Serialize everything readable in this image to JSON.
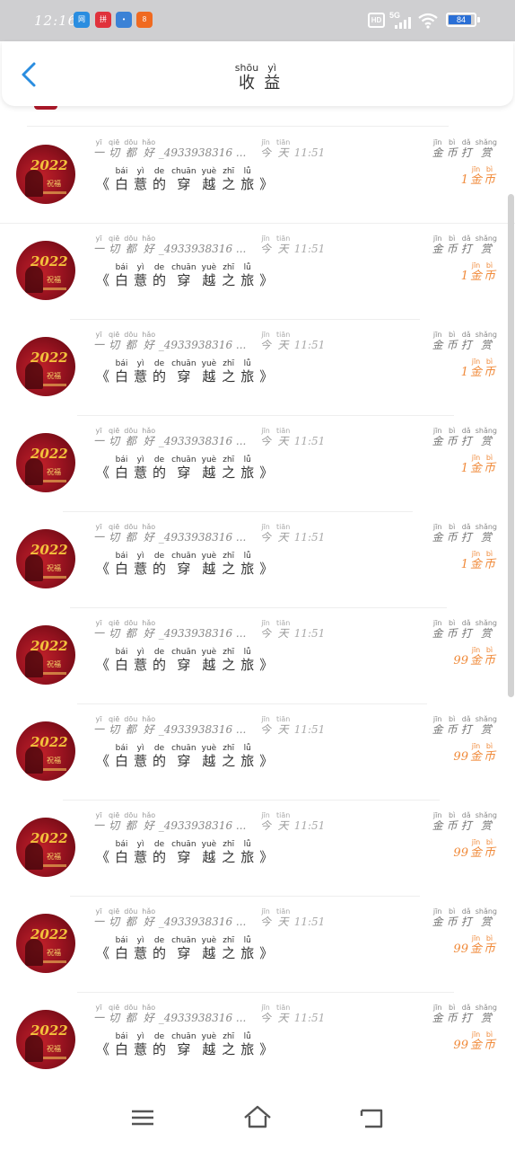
{
  "status_bar": {
    "time": "12:16",
    "apps": [
      {
        "icon": "app-blue-icon",
        "text": "网",
        "color": "#2a8de0"
      },
      {
        "icon": "app-red-icon",
        "text": "拼",
        "color": "#e0323c"
      },
      {
        "icon": "app-map-icon",
        "text": "•",
        "color": "#3b82d6"
      },
      {
        "icon": "app-orange-icon",
        "text": "8",
        "color": "#f06a20"
      }
    ],
    "hd": "HD",
    "network": "5G",
    "battery": "84",
    "battery_level": 0.84
  },
  "header": {
    "title_chars": [
      {
        "char": "收",
        "pinyin": "shōu"
      },
      {
        "char": "益",
        "pinyin": "yì"
      }
    ]
  },
  "avatar": {
    "year": "2022",
    "sub": "祝福"
  },
  "rows": [
    {
      "name": [
        {
          "c": "一",
          "p": "yī"
        },
        {
          "c": "切",
          "p": "qiē"
        },
        {
          "c": "都",
          "p": "dōu"
        },
        {
          "c": "好",
          "p": "hǎo"
        }
      ],
      "uid": "_4933938316 ...",
      "time": [
        {
          "c": "今",
          "p": "jīn"
        },
        {
          "c": "天",
          "p": "tiān"
        }
      ],
      "clock": "11:51",
      "tag": [
        {
          "c": "金",
          "p": "jīn"
        },
        {
          "c": "币",
          "p": "bì"
        },
        {
          "c": "打",
          "p": "dǎ"
        },
        {
          "c": "赏",
          "p": "shǎng"
        }
      ],
      "book": [
        {
          "c": "《",
          "p": ""
        },
        {
          "c": "白",
          "p": "bái"
        },
        {
          "c": "薏",
          "p": "yì"
        },
        {
          "c": "的",
          "p": "de"
        },
        {
          "c": "穿",
          "p": "chuān"
        },
        {
          "c": "越",
          "p": "yuè"
        },
        {
          "c": "之",
          "p": "zhī"
        },
        {
          "c": "旅",
          "p": "lǚ"
        },
        {
          "c": "》",
          "p": ""
        }
      ],
      "amount_num": "1",
      "amount_unit": [
        {
          "c": "金",
          "p": "jīn"
        },
        {
          "c": "币",
          "p": "bì"
        }
      ]
    },
    {
      "name": [
        {
          "c": "一",
          "p": "yī"
        },
        {
          "c": "切",
          "p": "qiē"
        },
        {
          "c": "都",
          "p": "dōu"
        },
        {
          "c": "好",
          "p": "hǎo"
        }
      ],
      "uid": "_4933938316 ...",
      "time": [
        {
          "c": "今",
          "p": "jīn"
        },
        {
          "c": "天",
          "p": "tiān"
        }
      ],
      "clock": "11:51",
      "tag": [
        {
          "c": "金",
          "p": "jīn"
        },
        {
          "c": "币",
          "p": "bì"
        },
        {
          "c": "打",
          "p": "dǎ"
        },
        {
          "c": "赏",
          "p": "shǎng"
        }
      ],
      "book": [
        {
          "c": "《",
          "p": ""
        },
        {
          "c": "白",
          "p": "bái"
        },
        {
          "c": "薏",
          "p": "yì"
        },
        {
          "c": "的",
          "p": "de"
        },
        {
          "c": "穿",
          "p": "chuān"
        },
        {
          "c": "越",
          "p": "yuè"
        },
        {
          "c": "之",
          "p": "zhī"
        },
        {
          "c": "旅",
          "p": "lǚ"
        },
        {
          "c": "》",
          "p": ""
        }
      ],
      "amount_num": "1",
      "amount_unit": [
        {
          "c": "金",
          "p": "jīn"
        },
        {
          "c": "币",
          "p": "bì"
        }
      ]
    },
    {
      "name": [
        {
          "c": "一",
          "p": "yī"
        },
        {
          "c": "切",
          "p": "qiē"
        },
        {
          "c": "都",
          "p": "dōu"
        },
        {
          "c": "好",
          "p": "hǎo"
        }
      ],
      "uid": "_4933938316 ...",
      "time": [
        {
          "c": "今",
          "p": "jīn"
        },
        {
          "c": "天",
          "p": "tiān"
        }
      ],
      "clock": "11:51",
      "tag": [
        {
          "c": "金",
          "p": "jīn"
        },
        {
          "c": "币",
          "p": "bì"
        },
        {
          "c": "打",
          "p": "dǎ"
        },
        {
          "c": "赏",
          "p": "shǎng"
        }
      ],
      "book": [
        {
          "c": "《",
          "p": ""
        },
        {
          "c": "白",
          "p": "bái"
        },
        {
          "c": "薏",
          "p": "yì"
        },
        {
          "c": "的",
          "p": "de"
        },
        {
          "c": "穿",
          "p": "chuān"
        },
        {
          "c": "越",
          "p": "yuè"
        },
        {
          "c": "之",
          "p": "zhī"
        },
        {
          "c": "旅",
          "p": "lǚ"
        },
        {
          "c": "》",
          "p": ""
        }
      ],
      "amount_num": "1",
      "amount_unit": [
        {
          "c": "金",
          "p": "jīn"
        },
        {
          "c": "币",
          "p": "bì"
        }
      ]
    },
    {
      "name": [
        {
          "c": "一",
          "p": "yī"
        },
        {
          "c": "切",
          "p": "qiē"
        },
        {
          "c": "都",
          "p": "dōu"
        },
        {
          "c": "好",
          "p": "hǎo"
        }
      ],
      "uid": "_4933938316 ...",
      "time": [
        {
          "c": "今",
          "p": "jīn"
        },
        {
          "c": "天",
          "p": "tiān"
        }
      ],
      "clock": "11:51",
      "tag": [
        {
          "c": "金",
          "p": "jīn"
        },
        {
          "c": "币",
          "p": "bì"
        },
        {
          "c": "打",
          "p": "dǎ"
        },
        {
          "c": "赏",
          "p": "shǎng"
        }
      ],
      "book": [
        {
          "c": "《",
          "p": ""
        },
        {
          "c": "白",
          "p": "bái"
        },
        {
          "c": "薏",
          "p": "yì"
        },
        {
          "c": "的",
          "p": "de"
        },
        {
          "c": "穿",
          "p": "chuān"
        },
        {
          "c": "越",
          "p": "yuè"
        },
        {
          "c": "之",
          "p": "zhī"
        },
        {
          "c": "旅",
          "p": "lǚ"
        },
        {
          "c": "》",
          "p": ""
        }
      ],
      "amount_num": "1",
      "amount_unit": [
        {
          "c": "金",
          "p": "jīn"
        },
        {
          "c": "币",
          "p": "bì"
        }
      ]
    },
    {
      "name": [
        {
          "c": "一",
          "p": "yī"
        },
        {
          "c": "切",
          "p": "qiē"
        },
        {
          "c": "都",
          "p": "dōu"
        },
        {
          "c": "好",
          "p": "hǎo"
        }
      ],
      "uid": "_4933938316 ...",
      "time": [
        {
          "c": "今",
          "p": "jīn"
        },
        {
          "c": "天",
          "p": "tiān"
        }
      ],
      "clock": "11:51",
      "tag": [
        {
          "c": "金",
          "p": "jīn"
        },
        {
          "c": "币",
          "p": "bì"
        },
        {
          "c": "打",
          "p": "dǎ"
        },
        {
          "c": "赏",
          "p": "shǎng"
        }
      ],
      "book": [
        {
          "c": "《",
          "p": ""
        },
        {
          "c": "白",
          "p": "bái"
        },
        {
          "c": "薏",
          "p": "yì"
        },
        {
          "c": "的",
          "p": "de"
        },
        {
          "c": "穿",
          "p": "chuān"
        },
        {
          "c": "越",
          "p": "yuè"
        },
        {
          "c": "之",
          "p": "zhī"
        },
        {
          "c": "旅",
          "p": "lǚ"
        },
        {
          "c": "》",
          "p": ""
        }
      ],
      "amount_num": "1",
      "amount_unit": [
        {
          "c": "金",
          "p": "jīn"
        },
        {
          "c": "币",
          "p": "bì"
        }
      ]
    },
    {
      "name": [
        {
          "c": "一",
          "p": "yī"
        },
        {
          "c": "切",
          "p": "qiē"
        },
        {
          "c": "都",
          "p": "dōu"
        },
        {
          "c": "好",
          "p": "hǎo"
        }
      ],
      "uid": "_4933938316 ...",
      "time": [
        {
          "c": "今",
          "p": "jīn"
        },
        {
          "c": "天",
          "p": "tiān"
        }
      ],
      "clock": "11:51",
      "tag": [
        {
          "c": "金",
          "p": "jīn"
        },
        {
          "c": "币",
          "p": "bì"
        },
        {
          "c": "打",
          "p": "dǎ"
        },
        {
          "c": "赏",
          "p": "shǎng"
        }
      ],
      "book": [
        {
          "c": "《",
          "p": ""
        },
        {
          "c": "白",
          "p": "bái"
        },
        {
          "c": "薏",
          "p": "yì"
        },
        {
          "c": "的",
          "p": "de"
        },
        {
          "c": "穿",
          "p": "chuān"
        },
        {
          "c": "越",
          "p": "yuè"
        },
        {
          "c": "之",
          "p": "zhī"
        },
        {
          "c": "旅",
          "p": "lǚ"
        },
        {
          "c": "》",
          "p": ""
        }
      ],
      "amount_num": "99",
      "amount_unit": [
        {
          "c": "金",
          "p": "jīn"
        },
        {
          "c": "币",
          "p": "bì"
        }
      ]
    },
    {
      "name": [
        {
          "c": "一",
          "p": "yī"
        },
        {
          "c": "切",
          "p": "qiē"
        },
        {
          "c": "都",
          "p": "dōu"
        },
        {
          "c": "好",
          "p": "hǎo"
        }
      ],
      "uid": "_4933938316 ...",
      "time": [
        {
          "c": "今",
          "p": "jīn"
        },
        {
          "c": "天",
          "p": "tiān"
        }
      ],
      "clock": "11:51",
      "tag": [
        {
          "c": "金",
          "p": "jīn"
        },
        {
          "c": "币",
          "p": "bì"
        },
        {
          "c": "打",
          "p": "dǎ"
        },
        {
          "c": "赏",
          "p": "shǎng"
        }
      ],
      "book": [
        {
          "c": "《",
          "p": ""
        },
        {
          "c": "白",
          "p": "bái"
        },
        {
          "c": "薏",
          "p": "yì"
        },
        {
          "c": "的",
          "p": "de"
        },
        {
          "c": "穿",
          "p": "chuān"
        },
        {
          "c": "越",
          "p": "yuè"
        },
        {
          "c": "之",
          "p": "zhī"
        },
        {
          "c": "旅",
          "p": "lǚ"
        },
        {
          "c": "》",
          "p": ""
        }
      ],
      "amount_num": "99",
      "amount_unit": [
        {
          "c": "金",
          "p": "jīn"
        },
        {
          "c": "币",
          "p": "bì"
        }
      ]
    },
    {
      "name": [
        {
          "c": "一",
          "p": "yī"
        },
        {
          "c": "切",
          "p": "qiē"
        },
        {
          "c": "都",
          "p": "dōu"
        },
        {
          "c": "好",
          "p": "hǎo"
        }
      ],
      "uid": "_4933938316 ...",
      "time": [
        {
          "c": "今",
          "p": "jīn"
        },
        {
          "c": "天",
          "p": "tiān"
        }
      ],
      "clock": "11:51",
      "tag": [
        {
          "c": "金",
          "p": "jīn"
        },
        {
          "c": "币",
          "p": "bì"
        },
        {
          "c": "打",
          "p": "dǎ"
        },
        {
          "c": "赏",
          "p": "shǎng"
        }
      ],
      "book": [
        {
          "c": "《",
          "p": ""
        },
        {
          "c": "白",
          "p": "bái"
        },
        {
          "c": "薏",
          "p": "yì"
        },
        {
          "c": "的",
          "p": "de"
        },
        {
          "c": "穿",
          "p": "chuān"
        },
        {
          "c": "越",
          "p": "yuè"
        },
        {
          "c": "之",
          "p": "zhī"
        },
        {
          "c": "旅",
          "p": "lǚ"
        },
        {
          "c": "》",
          "p": ""
        }
      ],
      "amount_num": "99",
      "amount_unit": [
        {
          "c": "金",
          "p": "jīn"
        },
        {
          "c": "币",
          "p": "bì"
        }
      ]
    },
    {
      "name": [
        {
          "c": "一",
          "p": "yī"
        },
        {
          "c": "切",
          "p": "qiē"
        },
        {
          "c": "都",
          "p": "dōu"
        },
        {
          "c": "好",
          "p": "hǎo"
        }
      ],
      "uid": "_4933938316 ...",
      "time": [
        {
          "c": "今",
          "p": "jīn"
        },
        {
          "c": "天",
          "p": "tiān"
        }
      ],
      "clock": "11:51",
      "tag": [
        {
          "c": "金",
          "p": "jīn"
        },
        {
          "c": "币",
          "p": "bì"
        },
        {
          "c": "打",
          "p": "dǎ"
        },
        {
          "c": "赏",
          "p": "shǎng"
        }
      ],
      "book": [
        {
          "c": "《",
          "p": ""
        },
        {
          "c": "白",
          "p": "bái"
        },
        {
          "c": "薏",
          "p": "yì"
        },
        {
          "c": "的",
          "p": "de"
        },
        {
          "c": "穿",
          "p": "chuān"
        },
        {
          "c": "越",
          "p": "yuè"
        },
        {
          "c": "之",
          "p": "zhī"
        },
        {
          "c": "旅",
          "p": "lǚ"
        },
        {
          "c": "》",
          "p": ""
        }
      ],
      "amount_num": "99",
      "amount_unit": [
        {
          "c": "金",
          "p": "jīn"
        },
        {
          "c": "币",
          "p": "bì"
        }
      ]
    },
    {
      "name": [
        {
          "c": "一",
          "p": "yī"
        },
        {
          "c": "切",
          "p": "qiē"
        },
        {
          "c": "都",
          "p": "dōu"
        },
        {
          "c": "好",
          "p": "hǎo"
        }
      ],
      "uid": "_4933938316 ...",
      "time": [
        {
          "c": "今",
          "p": "jīn"
        },
        {
          "c": "天",
          "p": "tiān"
        }
      ],
      "clock": "11:51",
      "tag": [
        {
          "c": "金",
          "p": "jīn"
        },
        {
          "c": "币",
          "p": "bì"
        },
        {
          "c": "打",
          "p": "dǎ"
        },
        {
          "c": "赏",
          "p": "shǎng"
        }
      ],
      "book": [
        {
          "c": "《",
          "p": ""
        },
        {
          "c": "白",
          "p": "bái"
        },
        {
          "c": "薏",
          "p": "yì"
        },
        {
          "c": "的",
          "p": "de"
        },
        {
          "c": "穿",
          "p": "chuān"
        },
        {
          "c": "越",
          "p": "yuè"
        },
        {
          "c": "之",
          "p": "zhī"
        },
        {
          "c": "旅",
          "p": "lǚ"
        },
        {
          "c": "》",
          "p": ""
        }
      ],
      "amount_num": "99",
      "amount_unit": [
        {
          "c": "金",
          "p": "jīn"
        },
        {
          "c": "币",
          "p": "bì"
        }
      ]
    }
  ],
  "colors": {
    "accent": "#2a8de0",
    "amount": "#f08a3a",
    "avatar_red": "#b0192a"
  },
  "navbar": {
    "items": [
      {
        "icon": "menu-icon"
      },
      {
        "icon": "home-icon"
      },
      {
        "icon": "back-nav-icon"
      }
    ]
  }
}
